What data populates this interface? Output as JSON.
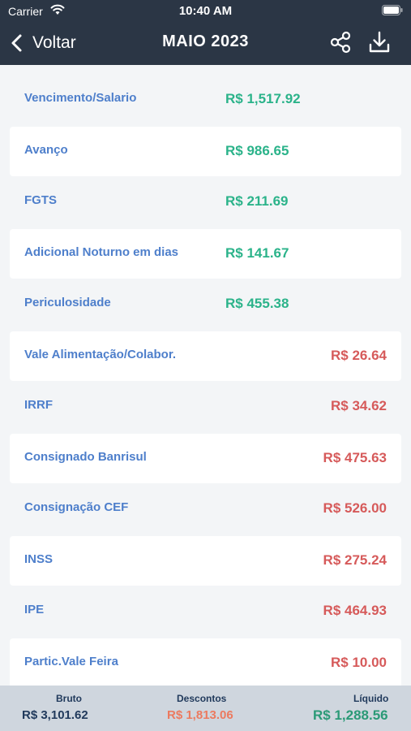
{
  "status": {
    "carrier": "Carrier",
    "time": "10:40 AM"
  },
  "nav": {
    "back_label": "Voltar",
    "title": "MAIO 2023"
  },
  "items": [
    {
      "label": "Vencimento/Salario",
      "value": "R$ 1,517.92",
      "kind": "earning"
    },
    {
      "label": "Avanço",
      "value": "R$ 986.65",
      "kind": "earning"
    },
    {
      "label": "FGTS",
      "value": "R$ 211.69",
      "kind": "earning"
    },
    {
      "label": "Adicional Noturno em dias",
      "value": "R$ 141.67",
      "kind": "earning"
    },
    {
      "label": "Periculosidade",
      "value": "R$ 455.38",
      "kind": "earning"
    },
    {
      "label": "Vale Alimentação/Colabor.",
      "value": "R$ 26.64",
      "kind": "deduction"
    },
    {
      "label": "IRRF",
      "value": "R$ 34.62",
      "kind": "deduction"
    },
    {
      "label": "Consignado Banrisul",
      "value": "R$ 475.63",
      "kind": "deduction"
    },
    {
      "label": "Consignação CEF",
      "value": "R$ 526.00",
      "kind": "deduction"
    },
    {
      "label": "INSS",
      "value": "R$ 275.24",
      "kind": "deduction"
    },
    {
      "label": "IPE",
      "value": "R$ 464.93",
      "kind": "deduction"
    },
    {
      "label": "Partic.Vale Feira",
      "value": "R$ 10.00",
      "kind": "deduction"
    }
  ],
  "summary": {
    "bruto_label": "Bruto",
    "bruto_value": "R$ 3,101.62",
    "descontos_label": "Descontos",
    "descontos_value": "R$ 1,813.06",
    "liquido_label": "Líquido",
    "liquido_value": "R$ 1,288.56"
  },
  "colors": {
    "header_bg": "#2b3645",
    "earning": "#2bb38a",
    "deduction": "#d65a5a",
    "label": "#4e7fcb",
    "footer_bg": "#cfd6de",
    "bruto": "#213a5c",
    "descontos": "#ec7a5f",
    "liquido": "#2b9a77"
  },
  "icons": [
    "wifi-icon",
    "battery-icon",
    "back-chevron-icon",
    "share-icon",
    "download-icon"
  ]
}
